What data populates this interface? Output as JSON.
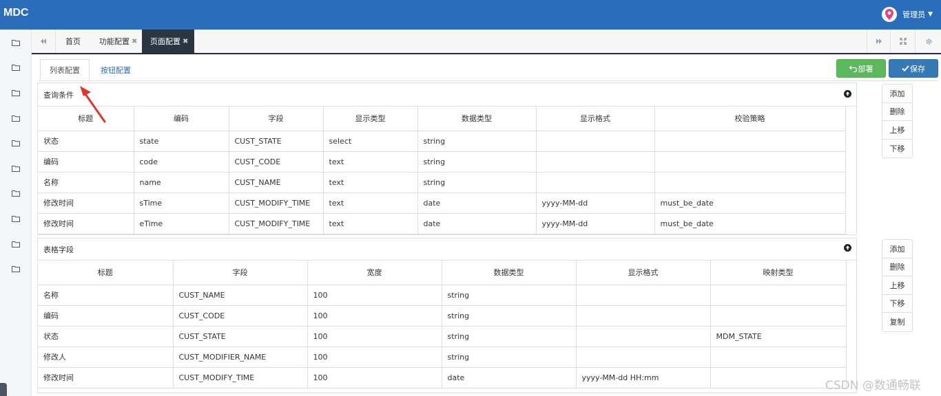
{
  "app": {
    "brand": "MDC",
    "user_name": "管理员"
  },
  "tabs": [
    {
      "label": "首页",
      "closable": false
    },
    {
      "label": "功能配置",
      "closable": true
    },
    {
      "label": "页面配置",
      "closable": true,
      "active": true
    }
  ],
  "subtabs": [
    {
      "label": "列表配置",
      "active": true
    },
    {
      "label": "按钮配置"
    }
  ],
  "buttons": {
    "deploy": "部署",
    "save": "保存"
  },
  "query_panel": {
    "title": "查询条件",
    "columns": [
      "标题",
      "编码",
      "字段",
      "显示类型",
      "数据类型",
      "显示格式",
      "校验策略"
    ],
    "rows": [
      [
        "状态",
        "state",
        "CUST_STATE",
        "select",
        "string",
        "",
        ""
      ],
      [
        "编码",
        "code",
        "CUST_CODE",
        "text",
        "string",
        "",
        ""
      ],
      [
        "名称",
        "name",
        "CUST_NAME",
        "text",
        "string",
        "",
        ""
      ],
      [
        "修改时间",
        "sTime",
        "CUST_MODIFY_TIME",
        "text",
        "date",
        "yyyy-MM-dd",
        "must_be_date"
      ],
      [
        "修改时间",
        "eTime",
        "CUST_MODIFY_TIME",
        "text",
        "date",
        "yyyy-MM-dd",
        "must_be_date"
      ]
    ],
    "actions": [
      "添加",
      "删除",
      "上移",
      "下移"
    ]
  },
  "grid_panel": {
    "title": "表格字段",
    "columns": [
      "标题",
      "字段",
      "宽度",
      "数据类型",
      "显示格式",
      "映射类型"
    ],
    "rows": [
      [
        "名称",
        "CUST_NAME",
        "100",
        "string",
        "",
        ""
      ],
      [
        "编码",
        "CUST_CODE",
        "100",
        "string",
        "",
        ""
      ],
      [
        "状态",
        "CUST_STATE",
        "100",
        "string",
        "",
        "MDM_STATE"
      ],
      [
        "修改人",
        "CUST_MODIFIER_NAME",
        "100",
        "string",
        "",
        ""
      ],
      [
        "修改时间",
        "CUST_MODIFY_TIME",
        "100",
        "date",
        "yyyy-MM-dd HH:mm",
        ""
      ]
    ],
    "actions": [
      "添加",
      "删除",
      "上移",
      "下移",
      "复制"
    ]
  },
  "watermark": "CSDN @数通畅联",
  "colors": {
    "navbar": "#2a6ebb",
    "active_tab": "#2b3643",
    "deploy": "#5cb85c",
    "save": "#337ab7",
    "arrow": "#e0352b"
  }
}
